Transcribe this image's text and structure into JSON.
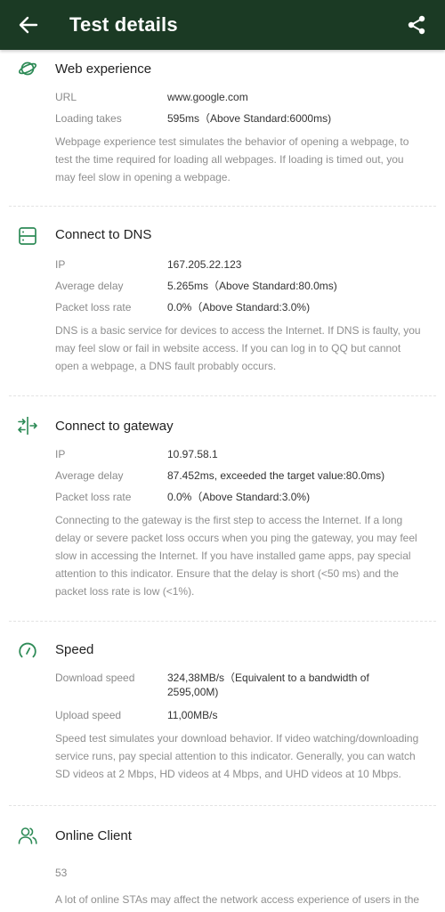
{
  "header": {
    "title": "Test details",
    "back_icon": "arrow-left-icon",
    "share_icon": "share-icon",
    "background": "#1b3a24"
  },
  "accent": "#2e8b57",
  "sections": {
    "web": {
      "icon": "planet-icon",
      "title": "Web experience",
      "rows": [
        {
          "label": "URL",
          "value": "www.google.com"
        },
        {
          "label": "Loading takes",
          "value": "595ms（Above Standard:6000ms)"
        }
      ],
      "description": "Webpage experience test simulates the behavior of opening a webpage, to test the time required for loading all webpages. If loading is timed out, you may feel slow in opening a webpage."
    },
    "dns": {
      "icon": "server-icon",
      "title": "Connect to DNS",
      "rows": [
        {
          "label": "IP",
          "value": "167.205.22.123"
        },
        {
          "label": "Average delay",
          "value": "5.265ms（Above Standard:80.0ms)"
        },
        {
          "label": "Packet loss rate",
          "value": "0.0%（Above Standard:3.0%)"
        }
      ],
      "description": "DNS is a basic service for devices to access the Internet. If DNS is faulty, you may feel slow or fail in website access. If you can log in to QQ but cannot open a webpage, a DNS fault probably occurs."
    },
    "gateway": {
      "icon": "gateway-icon",
      "title": "Connect to gateway",
      "rows": [
        {
          "label": "IP",
          "value": "10.97.58.1"
        },
        {
          "label": "Average delay",
          "value": "87.452ms, exceeded the target value:80.0ms)"
        },
        {
          "label": "Packet loss rate",
          "value": "0.0%（Above Standard:3.0%)"
        }
      ],
      "description": "Connecting to the gateway is the first step to access the Internet. If a long delay or severe packet loss occurs when you ping the gateway, you may feel slow in accessing the Internet. If you have installed game apps, pay special attention to this indicator. Ensure that the delay is short (<50 ms) and the packet loss rate is low (<1%)."
    },
    "speed": {
      "icon": "speedometer-icon",
      "title": "Speed",
      "rows": [
        {
          "label": "Download speed",
          "value": "324,38MB/s（Equivalent to a bandwidth of 2595,00M)"
        },
        {
          "label": "Upload speed",
          "value": "11,00MB/s"
        }
      ],
      "description": "Speed test simulates your download behavior. If video watching/downloading service runs, pay special attention to this indicator. Generally, you can watch SD videos at 2 Mbps, HD videos at 4 Mbps, and UHD videos at 10 Mbps."
    },
    "clients": {
      "icon": "users-icon",
      "title": "Online Client",
      "count": "53",
      "description": "A lot of online STAs may affect the network access experience of users in the"
    }
  }
}
